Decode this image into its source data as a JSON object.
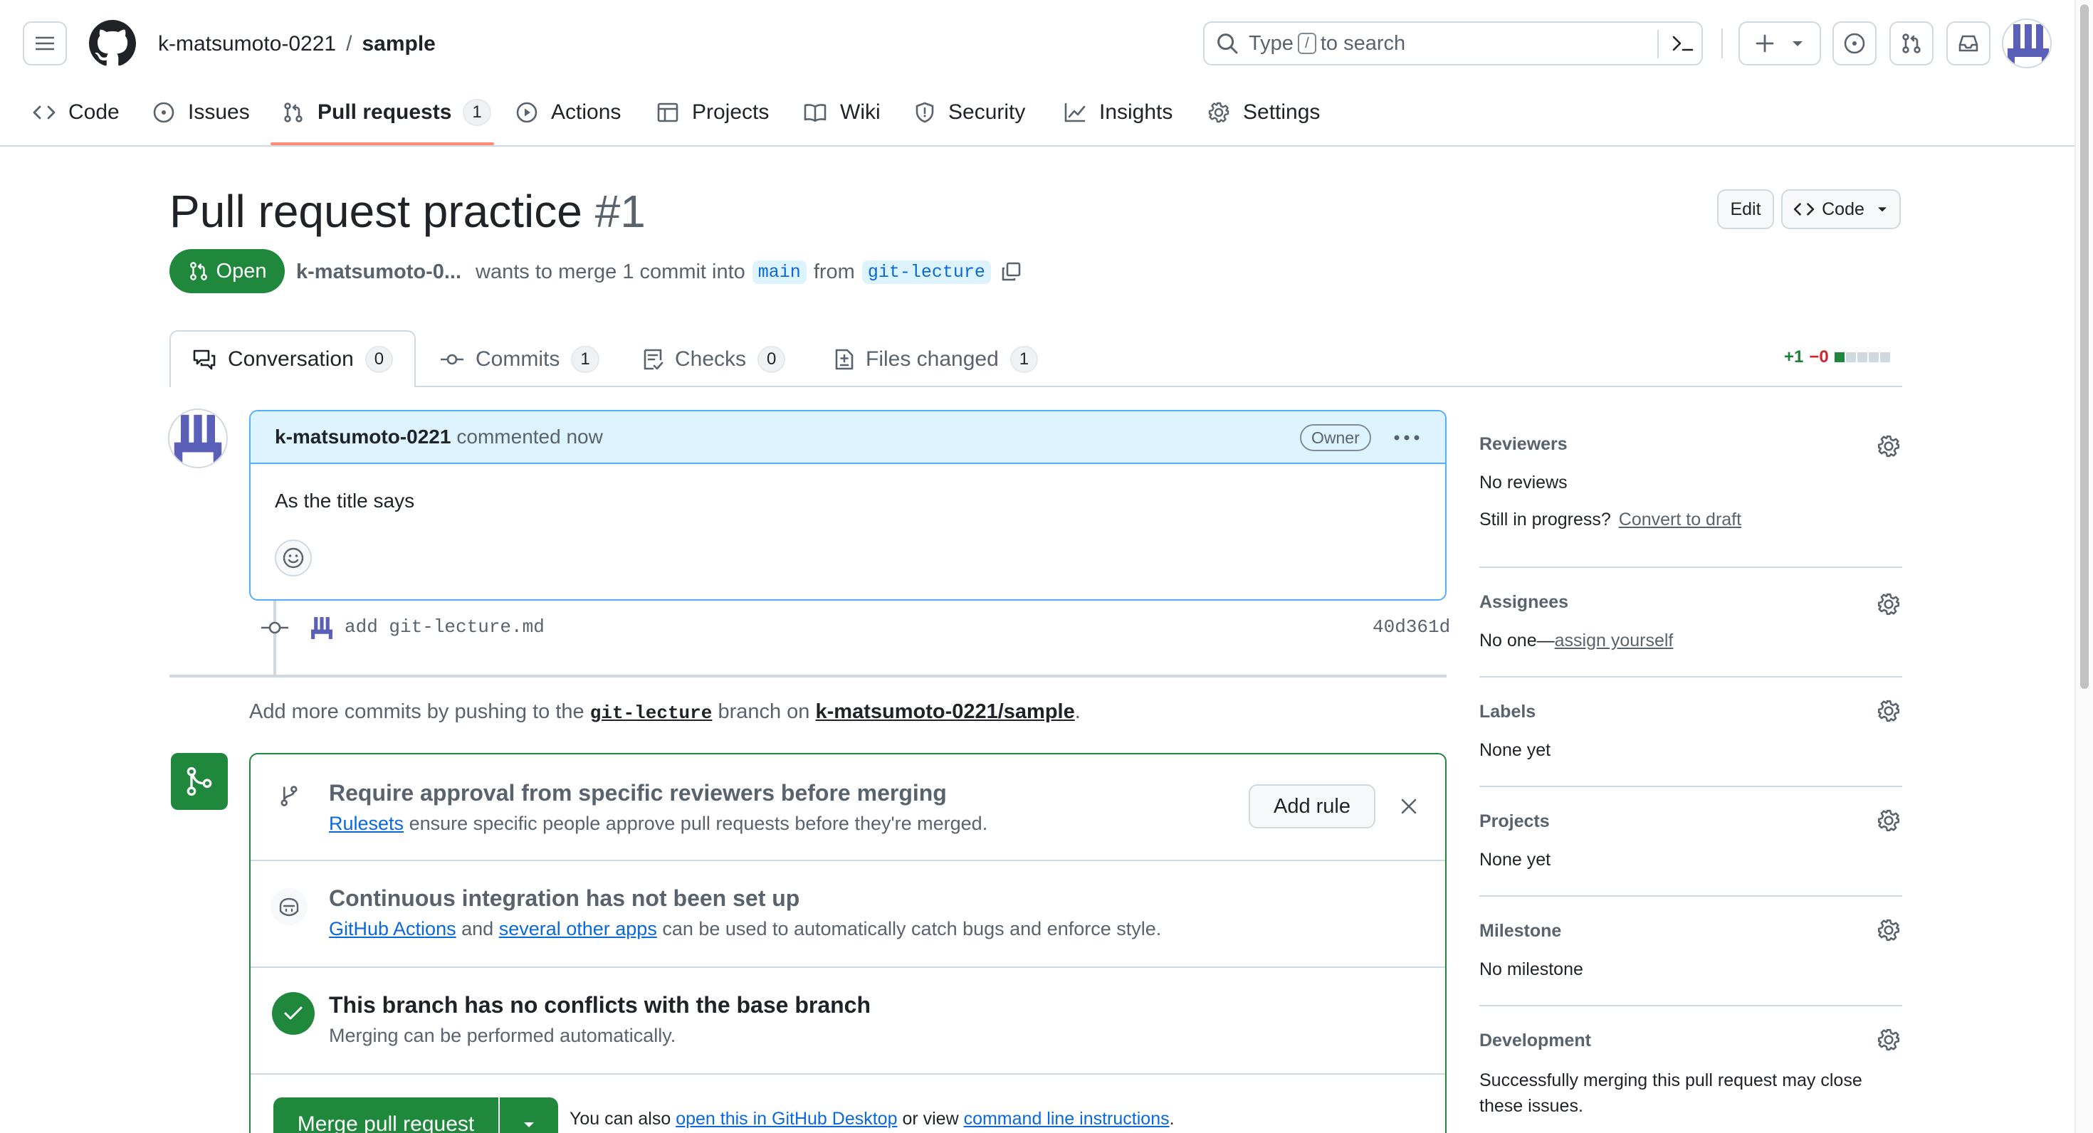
{
  "header": {
    "owner": "k-matsumoto-0221",
    "separator": "/",
    "repo": "sample",
    "search_pre": "Type",
    "search_key": "/",
    "search_post": "to search",
    "plus_label": "+"
  },
  "repo_nav": {
    "code": "Code",
    "issues": "Issues",
    "pull_requests": "Pull requests",
    "pull_requests_count": "1",
    "actions": "Actions",
    "projects": "Projects",
    "wiki": "Wiki",
    "security": "Security",
    "insights": "Insights",
    "settings": "Settings"
  },
  "pr": {
    "title": "Pull request practice",
    "number": "#1",
    "edit_label": "Edit",
    "code_label": "Code",
    "state": "Open",
    "author_short": "k-matsumoto-0...",
    "wants_text": "wants to merge 1 commit into",
    "base_branch": "main",
    "from_text": "from",
    "head_branch": "git-lecture"
  },
  "tabs": {
    "conversation": "Conversation",
    "conversation_count": "0",
    "commits": "Commits",
    "commits_count": "1",
    "checks": "Checks",
    "checks_count": "0",
    "files": "Files changed",
    "files_count": "1",
    "additions": "+1",
    "deletions": "−0"
  },
  "comment": {
    "author": "k-matsumoto-0221",
    "action": "commented now",
    "badge": "Owner",
    "body": "As the title says"
  },
  "commit": {
    "message": "add git-lecture.md",
    "sha": "40d361d"
  },
  "push_hint": {
    "pre": "Add more commits by pushing to the",
    "branch": "git-lecture",
    "mid": "branch on",
    "repo": "k-matsumoto-0221/sample",
    "post": "."
  },
  "merge_box": {
    "rule_title": "Require approval from specific reviewers before merging",
    "rule_link": "Rulesets",
    "rule_desc": "ensure specific people approve pull requests before they're merged.",
    "add_rule": "Add rule",
    "ci_title": "Continuous integration has not been set up",
    "ci_link1": "GitHub Actions",
    "ci_and": "and",
    "ci_link2": "several other apps",
    "ci_desc": "can be used to automatically catch bugs and enforce style.",
    "conflict_title": "This branch has no conflicts with the base branch",
    "conflict_desc": "Merging can be performed automatically.",
    "merge_button": "Merge pull request",
    "also_text": "You can also",
    "desktop_link": "open this in GitHub Desktop",
    "or_view": "or view",
    "cli_link": "command line instructions",
    "end": "."
  },
  "sidebar": {
    "reviewers_title": "Reviewers",
    "reviewers_value": "No reviews",
    "in_progress": "Still in progress?",
    "convert_draft": "Convert to draft",
    "assignees_title": "Assignees",
    "assignees_value": "No one—",
    "assign_yourself": "assign yourself",
    "labels_title": "Labels",
    "labels_value": "None yet",
    "projects_title": "Projects",
    "projects_value": "None yet",
    "milestone_title": "Milestone",
    "milestone_value": "No milestone",
    "development_title": "Development",
    "development_value": "Successfully merging this pull request may close these issues."
  },
  "colors": {
    "open_green": "#1f883d",
    "merge_green": "#1f883d",
    "link_blue": "#0969da",
    "active_tab_underline": "#fd8c73",
    "comment_header_bg": "#ddf4ff"
  }
}
